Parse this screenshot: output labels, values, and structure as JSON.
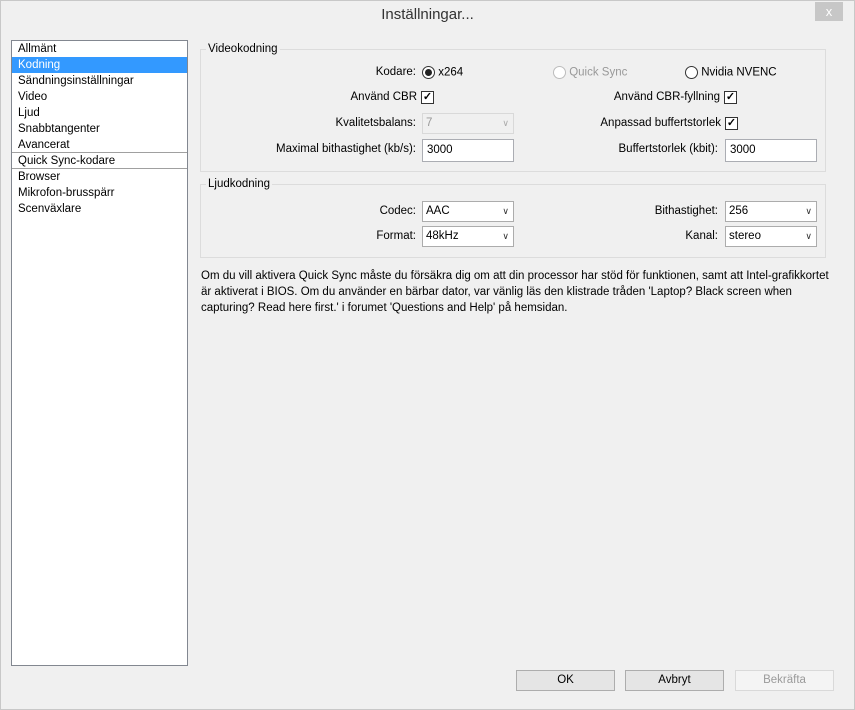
{
  "window": {
    "title": "Inställningar...",
    "close": "x"
  },
  "sidebar": {
    "items": [
      {
        "label": "Allmänt"
      },
      {
        "label": "Kodning"
      },
      {
        "label": "Sändningsinställningar"
      },
      {
        "label": "Video"
      },
      {
        "label": "Ljud"
      },
      {
        "label": "Snabbtangenter"
      },
      {
        "label": "Avancerat"
      },
      {
        "label": "Quick Sync-kodare"
      },
      {
        "label": "Browser"
      },
      {
        "label": "Mikrofon-brusspärr"
      },
      {
        "label": "Scenväxlare"
      }
    ],
    "selected": "Kodning"
  },
  "video": {
    "title": "Videokodning",
    "encoder_label": "Kodare:",
    "encoders": [
      {
        "label": "x264",
        "checked": true
      },
      {
        "label": "Quick Sync",
        "disabled": true
      },
      {
        "label": "Nvidia NVENC"
      }
    ],
    "cbr_label": "Använd CBR",
    "cbr_checked": true,
    "cbr_fill_label": "Använd CBR-fyllning",
    "cbr_fill_checked": true,
    "quality_label": "Kvalitetsbalans:",
    "quality_value": "7",
    "custom_buffer_label": "Anpassad buffertstorlek",
    "custom_buffer_checked": true,
    "max_bitrate_label": "Maximal bithastighet (kb/s):",
    "max_bitrate_value": "3000",
    "buffer_label": "Buffertstorlek (kbit):",
    "buffer_value": "3000"
  },
  "audio": {
    "title": "Ljudkodning",
    "codec_label": "Codec:",
    "codec_value": "AAC",
    "format_label": "Format:",
    "format_value": "48kHz",
    "bitrate_label": "Bithastighet:",
    "bitrate_value": "256",
    "channel_label": "Kanal:",
    "channel_value": "stereo"
  },
  "info": "Om du vill aktivera Quick Sync måste du försäkra dig om att din processor har stöd för funktionen, samt att Intel-grafikkortet är aktiverat i BIOS. Om du använder en bärbar dator, var vänlig läs den klistrade tråden 'Laptop? Black screen when capturing? Read here first.' i forumet 'Questions and Help' på hemsidan.",
  "buttons": {
    "ok": "OK",
    "cancel": "Avbryt",
    "apply": "Bekräfta"
  }
}
